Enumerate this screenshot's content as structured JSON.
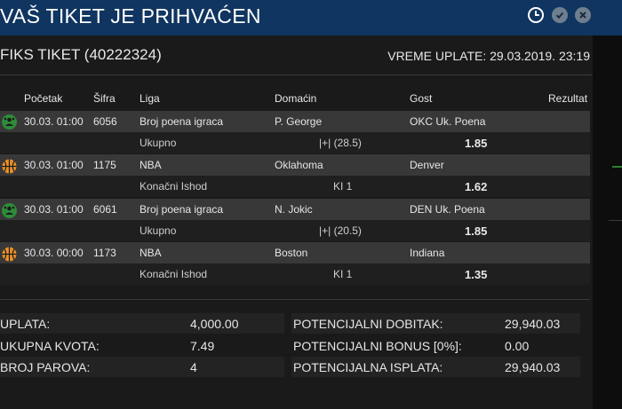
{
  "header": {
    "title": "VAŠ TIKET JE PRIHVAĆEN",
    "icons": [
      "clock-icon",
      "check-icon",
      "close-icon"
    ]
  },
  "ticket": {
    "name": "FIKS TIKET (40222324)",
    "payment_time": "VREME UPLATE: 29.03.2019. 23:19"
  },
  "columns": {
    "start": "Početak",
    "code": "Šifra",
    "league": "Liga",
    "home": "Domaćin",
    "away": "Gost",
    "result": "Rezultat"
  },
  "matches": [
    {
      "sport_icon": "player-points-icon",
      "start": "30.03. 01:00",
      "code": "6056",
      "league": "Broj poena igraca",
      "home": "P. George",
      "away": "OKC Uk. Poena",
      "bet_type": "Ukupno",
      "bet_pick": "|+| (28.5)",
      "odd": "1.85"
    },
    {
      "sport_icon": "basketball-icon",
      "start": "30.03. 01:00",
      "code": "1175",
      "league": "NBA",
      "home": "Oklahoma",
      "away": "Denver",
      "bet_type": "Konačni Ishod",
      "bet_pick": "KI 1",
      "odd": "1.62"
    },
    {
      "sport_icon": "player-points-icon",
      "start": "30.03. 01:00",
      "code": "6061",
      "league": "Broj poena igraca",
      "home": "N. Jokic",
      "away": "DEN Uk. Poena",
      "bet_type": "Ukupno",
      "bet_pick": "|+| (20.5)",
      "odd": "1.85"
    },
    {
      "sport_icon": "basketball-icon",
      "start": "30.03. 00:00",
      "code": "1173",
      "league": "NBA",
      "home": "Boston",
      "away": "Indiana",
      "bet_type": "Konačni Ishod",
      "bet_pick": "KI 1",
      "odd": "1.35"
    }
  ],
  "summary": {
    "payment_label": "UPLATA:",
    "payment_value": "4,000.00",
    "total_odds_label": "UKUPNA KVOTA:",
    "total_odds_value": "7.49",
    "pairs_label": "BROJ PAROVA:",
    "pairs_value": "4",
    "potential_win_label": "POTENCIJALNI DOBITAK:",
    "potential_win_value": "29,940.03",
    "bonus_label": "POTENCIJALNI BONUS [0%]:",
    "bonus_value": "0.00",
    "payout_label": "POTENCIJALNA ISPLATA:",
    "payout_value": "29,940.03"
  },
  "colors": {
    "titlebar": "#0f3560",
    "background": "#1a1a1a",
    "match_row": "#383838",
    "player_icon": "#2e8b3a",
    "basketball_icon": "#e8902a"
  }
}
